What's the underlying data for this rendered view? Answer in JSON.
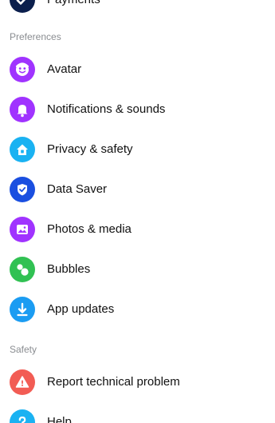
{
  "top_partial_item": {
    "label": "Payments",
    "icon": "payments-icon",
    "color": "#0b1f4d"
  },
  "sections": {
    "preferences": {
      "title": "Preferences",
      "items": [
        {
          "label": "Avatar",
          "icon": "avatar-face-icon",
          "color": "#a033ff"
        },
        {
          "label": "Notifications & sounds",
          "icon": "bell-icon",
          "color": "#a033ff"
        },
        {
          "label": "Privacy & safety",
          "icon": "house-lock-icon",
          "color": "#1ab2f2"
        },
        {
          "label": "Data Saver",
          "icon": "shield-check-icon",
          "color": "#1a4fe0"
        },
        {
          "label": "Photos & media",
          "icon": "image-icon",
          "color": "#a033ff"
        },
        {
          "label": "Bubbles",
          "icon": "bubbles-icon",
          "color": "#31c153"
        },
        {
          "label": "App updates",
          "icon": "download-icon",
          "color": "#1b9cf2"
        }
      ]
    },
    "safety": {
      "title": "Safety",
      "items": [
        {
          "label": "Report technical problem",
          "icon": "warning-icon",
          "color": "#f25c54"
        },
        {
          "label": "Help",
          "icon": "help-icon",
          "color": "#1ab2f2"
        }
      ]
    }
  }
}
